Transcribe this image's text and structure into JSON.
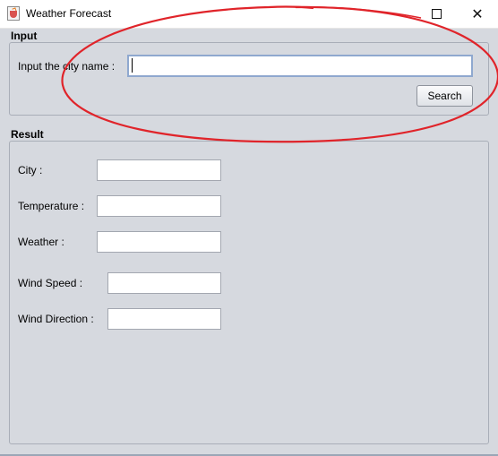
{
  "window": {
    "title": "Weather Forecast",
    "icon": "java-cup-icon",
    "minimize_glyph": "",
    "maximize_glyph": "",
    "close_glyph": "✕"
  },
  "input_section": {
    "heading": "Input",
    "city_label": "Input the city name :",
    "city_value": "",
    "search_label": "Search"
  },
  "result_section": {
    "heading": "Result",
    "fields": [
      {
        "label": "City :",
        "value": ""
      },
      {
        "label": "Temperature :",
        "value": ""
      },
      {
        "label": "Weather :",
        "value": ""
      },
      {
        "label": "Wind Speed :",
        "value": ""
      },
      {
        "label": "Wind Direction :",
        "value": ""
      }
    ]
  },
  "colors": {
    "annotation": "#e0242a",
    "background": "#d6d9df",
    "focus_border": "#8fa8cf"
  }
}
